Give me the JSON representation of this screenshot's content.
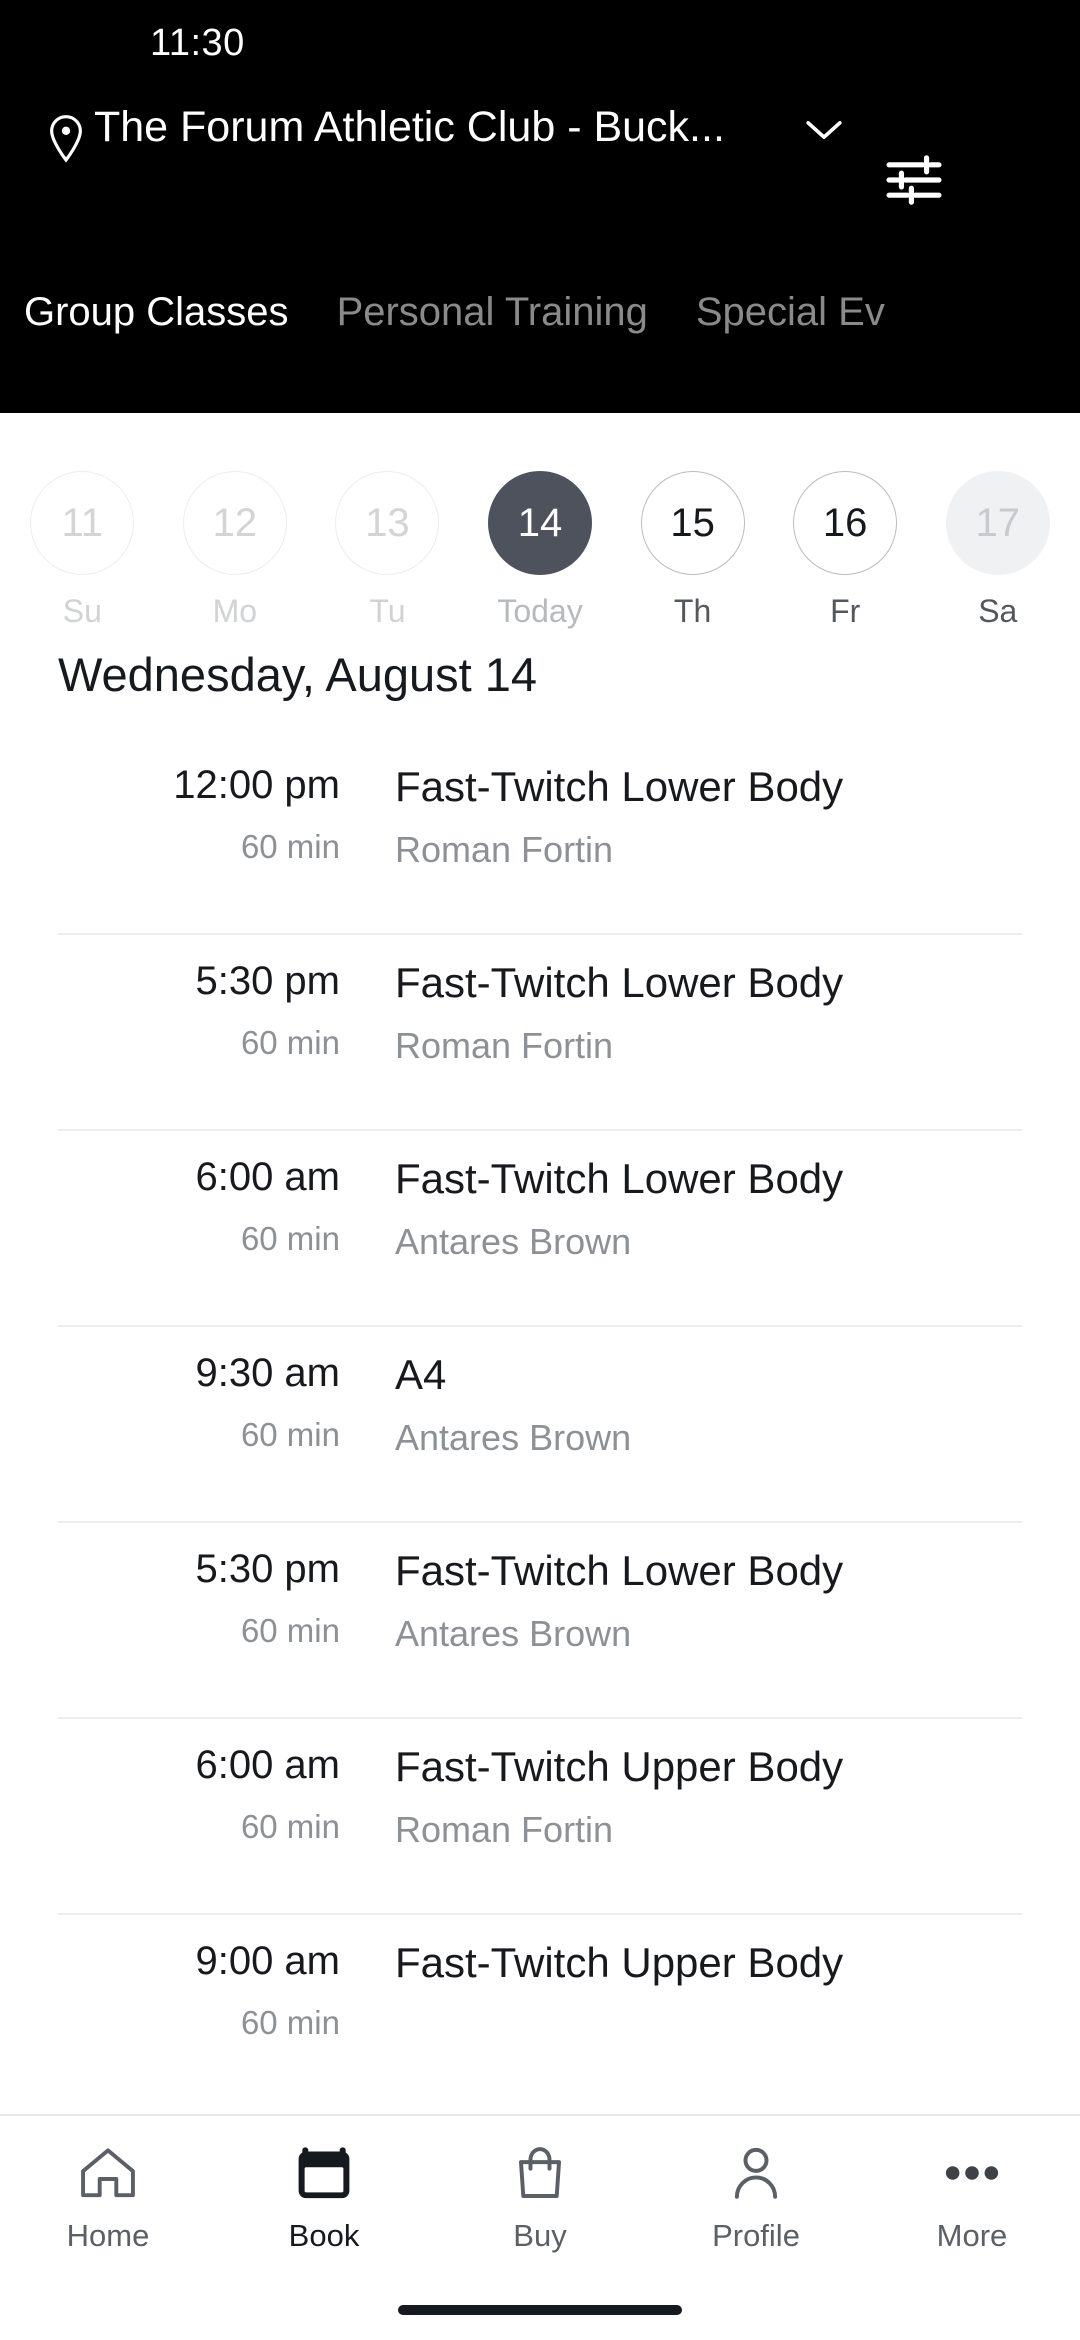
{
  "statusbar": {
    "time": "11:30"
  },
  "header": {
    "pin_icon": "location-pin-icon",
    "venue": "The Forum Athletic Club - Buck...",
    "chevron_icon": "chevron-down-icon",
    "filter_icon": "tune-sliders-icon",
    "tabs": [
      {
        "label": "Group Classes",
        "active": true
      },
      {
        "label": "Personal Training",
        "active": false
      },
      {
        "label": "Special Ev",
        "active": false
      }
    ]
  },
  "date_strip": [
    {
      "day": "11",
      "label": "Su",
      "state": "past"
    },
    {
      "day": "12",
      "label": "Mo",
      "state": "past"
    },
    {
      "day": "13",
      "label": "Tu",
      "state": "past"
    },
    {
      "day": "14",
      "label": "Today",
      "state": "selected"
    },
    {
      "day": "15",
      "label": "Th",
      "state": "available"
    },
    {
      "day": "16",
      "label": "Fr",
      "state": "available"
    },
    {
      "day": "17",
      "label": "Sa",
      "state": "tail"
    }
  ],
  "day_heading": "Wednesday, August 14",
  "classes": [
    {
      "time": "12:00 pm",
      "duration": "60 min",
      "name": "Fast-Twitch Lower Body",
      "instructor": "Roman Fortin"
    },
    {
      "time": "5:30 pm",
      "duration": "60 min",
      "name": "Fast-Twitch Lower Body",
      "instructor": "Roman Fortin"
    },
    {
      "time": "6:00 am",
      "duration": "60 min",
      "name": "Fast-Twitch Lower Body",
      "instructor": "Antares Brown"
    },
    {
      "time": "9:30 am",
      "duration": "60 min",
      "name": "A4",
      "instructor": "Antares Brown"
    },
    {
      "time": "5:30 pm",
      "duration": "60 min",
      "name": "Fast-Twitch Lower Body",
      "instructor": "Antares Brown"
    },
    {
      "time": "6:00 am",
      "duration": "60 min",
      "name": "Fast-Twitch Upper Body",
      "instructor": "Roman Fortin"
    },
    {
      "time": "9:00 am",
      "duration": "60 min",
      "name": "Fast-Twitch Upper Body",
      "instructor": ""
    }
  ],
  "bottom_nav": [
    {
      "label": "Home",
      "icon": "home-icon",
      "active": false
    },
    {
      "label": "Book",
      "icon": "calendar-icon",
      "active": true
    },
    {
      "label": "Buy",
      "icon": "shopping-bag-icon",
      "active": false
    },
    {
      "label": "Profile",
      "icon": "person-icon",
      "active": false
    },
    {
      "label": "More",
      "icon": "ellipsis-icon",
      "active": false
    }
  ],
  "colors": {
    "header_bg": "#000000",
    "selected_date": "#4e525c",
    "text_primary": "#17191d",
    "text_muted": "#8d9094",
    "divider": "#eceeef"
  }
}
